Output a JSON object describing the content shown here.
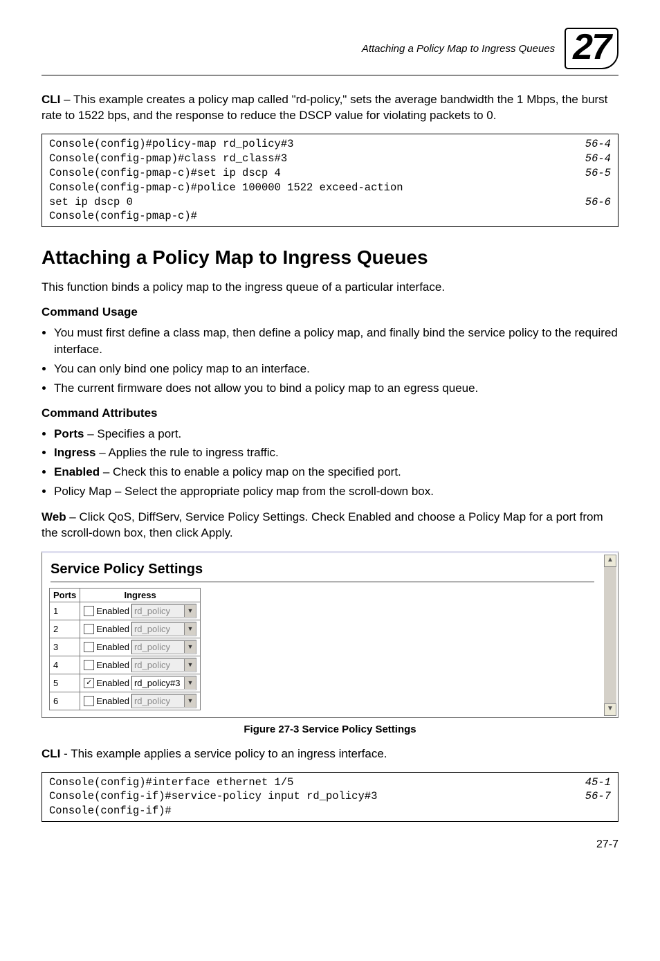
{
  "header": {
    "title": "Attaching a Policy Map to Ingress Queues",
    "chapter": "27"
  },
  "intro": {
    "lead": "CLI",
    "body": " – This example creates a policy map called \"rd-policy,\" sets the average bandwidth the 1 Mbps, the burst rate to 1522 bps, and the response to reduce the DSCP value for violating packets to 0."
  },
  "code1": [
    {
      "cmd": "Console(config)#policy-map rd_policy#3",
      "ref": "56-4"
    },
    {
      "cmd": "Console(config-pmap)#class rd_class#3",
      "ref": "56-4"
    },
    {
      "cmd": "Console(config-pmap-c)#set ip dscp 4",
      "ref": "56-5"
    },
    {
      "cmd": "Console(config-pmap-c)#police 100000 1522 exceed-action",
      "ref": ""
    },
    {
      "cmd": " set ip dscp 0",
      "ref": "56-6"
    },
    {
      "cmd": "Console(config-pmap-c)#",
      "ref": ""
    }
  ],
  "section": {
    "title": "Attaching a Policy Map to Ingress Queues",
    "intro": "This function binds a policy map to the ingress queue of a particular interface."
  },
  "usage": {
    "title": "Command Usage",
    "items": [
      "You must first define a class map, then define a policy map, and finally bind the service policy to the required interface.",
      "You can only bind one policy map to an interface.",
      "The current firmware does not allow you to bind a policy map to an egress queue."
    ]
  },
  "attrs": {
    "title": "Command Attributes",
    "items": [
      {
        "b": "Ports",
        "t": " – Specifies a port."
      },
      {
        "b": "Ingress",
        "t": " – Applies the rule to ingress traffic."
      },
      {
        "b": "Enabled",
        "t": " – Check this to enable a policy map on the specified port."
      },
      {
        "b": "",
        "t": "Policy Map – Select the appropriate policy map from the scroll-down box."
      }
    ]
  },
  "webpara": {
    "lead": "Web",
    "body": " – Click QoS, DiffServ, Service Policy Settings. Check Enabled and choose a Policy Map for a port from the scroll-down box, then click Apply."
  },
  "fig": {
    "heading": "Service Policy Settings",
    "cols": {
      "ports": "Ports",
      "ingress": "Ingress"
    },
    "rows": [
      {
        "port": "1",
        "checked": false,
        "enabled_label": "Enabled",
        "value": "rd_policy",
        "gray": true
      },
      {
        "port": "2",
        "checked": false,
        "enabled_label": "Enabled",
        "value": "rd_policy",
        "gray": true
      },
      {
        "port": "3",
        "checked": false,
        "enabled_label": "Enabled",
        "value": "rd_policy",
        "gray": true
      },
      {
        "port": "4",
        "checked": false,
        "enabled_label": "Enabled",
        "value": "rd_policy",
        "gray": true
      },
      {
        "port": "5",
        "checked": true,
        "enabled_label": "Enabled",
        "value": "rd_policy#3",
        "gray": false
      },
      {
        "port": "6",
        "checked": false,
        "enabled_label": "Enabled",
        "value": "rd_policy",
        "gray": true
      }
    ],
    "caption": "Figure 27-3  Service Policy Settings"
  },
  "clipara": {
    "lead": "CLI",
    "body": " - This example applies a service policy to an ingress interface."
  },
  "code2": [
    {
      "cmd": "Console(config)#interface ethernet 1/5",
      "ref": "45-1"
    },
    {
      "cmd": "Console(config-if)#service-policy input rd_policy#3",
      "ref": "56-7"
    },
    {
      "cmd": "Console(config-if)#",
      "ref": ""
    }
  ],
  "pagenum": "27-7"
}
